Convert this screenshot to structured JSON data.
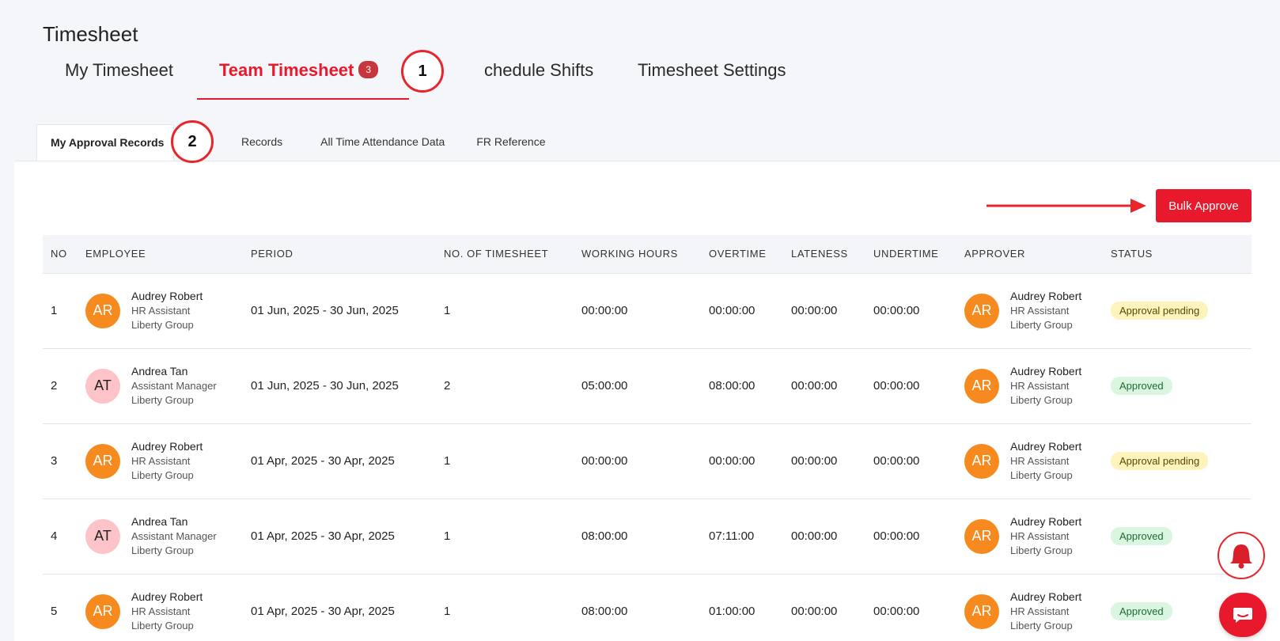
{
  "page": {
    "title": "Timesheet"
  },
  "main_tabs": [
    {
      "label": "My Timesheet"
    },
    {
      "label": "Team Timesheet",
      "badge": "3"
    },
    {
      "label": "chedule Shifts"
    },
    {
      "label": "Timesheet Settings"
    }
  ],
  "markers": {
    "one": "1",
    "two": "2"
  },
  "sub_tabs": [
    {
      "label": "My Approval Records"
    },
    {
      "label": "Records"
    },
    {
      "label": "All Time Attendance Data"
    },
    {
      "label": "FR Reference"
    }
  ],
  "actions": {
    "bulk_approve": "Bulk Approve"
  },
  "table": {
    "headers": [
      "NO",
      "EMPLOYEE",
      "PERIOD",
      "NO. OF TIMESHEET",
      "WORKING HOURS",
      "OVERTIME",
      "LATENESS",
      "UNDERTIME",
      "APPROVER",
      "STATUS"
    ],
    "rows": [
      {
        "no": "1",
        "employee": {
          "initials": "AR",
          "name": "Audrey Robert",
          "role": "HR Assistant",
          "company": "Liberty Group"
        },
        "period": "01 Jun, 2025 - 30 Jun, 2025",
        "count": "1",
        "working": "00:00:00",
        "overtime": "00:00:00",
        "lateness": "00:00:00",
        "undertime": "00:00:00",
        "approver": {
          "initials": "AR",
          "name": "Audrey Robert",
          "role": "HR Assistant",
          "company": "Liberty Group"
        },
        "status": "Approval pending"
      },
      {
        "no": "2",
        "employee": {
          "initials": "AT",
          "name": "Andrea Tan",
          "role": "Assistant Manager",
          "company": "Liberty Group"
        },
        "period": "01 Jun, 2025 - 30 Jun, 2025",
        "count": "2",
        "working": "05:00:00",
        "overtime": "08:00:00",
        "lateness": "00:00:00",
        "undertime": "00:00:00",
        "approver": {
          "initials": "AR",
          "name": "Audrey Robert",
          "role": "HR Assistant",
          "company": "Liberty Group"
        },
        "status": "Approved"
      },
      {
        "no": "3",
        "employee": {
          "initials": "AR",
          "name": "Audrey Robert",
          "role": "HR Assistant",
          "company": "Liberty Group"
        },
        "period": "01 Apr, 2025 - 30 Apr, 2025",
        "count": "1",
        "working": "00:00:00",
        "overtime": "00:00:00",
        "lateness": "00:00:00",
        "undertime": "00:00:00",
        "approver": {
          "initials": "AR",
          "name": "Audrey Robert",
          "role": "HR Assistant",
          "company": "Liberty Group"
        },
        "status": "Approval pending"
      },
      {
        "no": "4",
        "employee": {
          "initials": "AT",
          "name": "Andrea Tan",
          "role": "Assistant Manager",
          "company": "Liberty Group"
        },
        "period": "01 Apr, 2025 - 30 Apr, 2025",
        "count": "1",
        "working": "08:00:00",
        "overtime": "07:11:00",
        "lateness": "00:00:00",
        "undertime": "00:00:00",
        "approver": {
          "initials": "AR",
          "name": "Audrey Robert",
          "role": "HR Assistant",
          "company": "Liberty Group"
        },
        "status": "Approved"
      },
      {
        "no": "5",
        "employee": {
          "initials": "AR",
          "name": "Audrey Robert",
          "role": "HR Assistant",
          "company": "Liberty Group"
        },
        "period": "01 Apr, 2025 - 30 Apr, 2025",
        "count": "1",
        "working": "08:00:00",
        "overtime": "01:00:00",
        "lateness": "00:00:00",
        "undertime": "00:00:00",
        "approver": {
          "initials": "AR",
          "name": "Audrey Robert",
          "role": "HR Assistant",
          "company": "Liberty Group"
        },
        "status": "Approved"
      }
    ]
  },
  "icons": {
    "bell": "bell-icon",
    "chat": "chat-icon"
  },
  "colors": {
    "accent": "#e8192c",
    "avatar_orange": "#f68a1e",
    "avatar_pink": "#fcc4c8",
    "pending_bg": "#fdf3bd",
    "approved_bg": "#daf5e0"
  }
}
